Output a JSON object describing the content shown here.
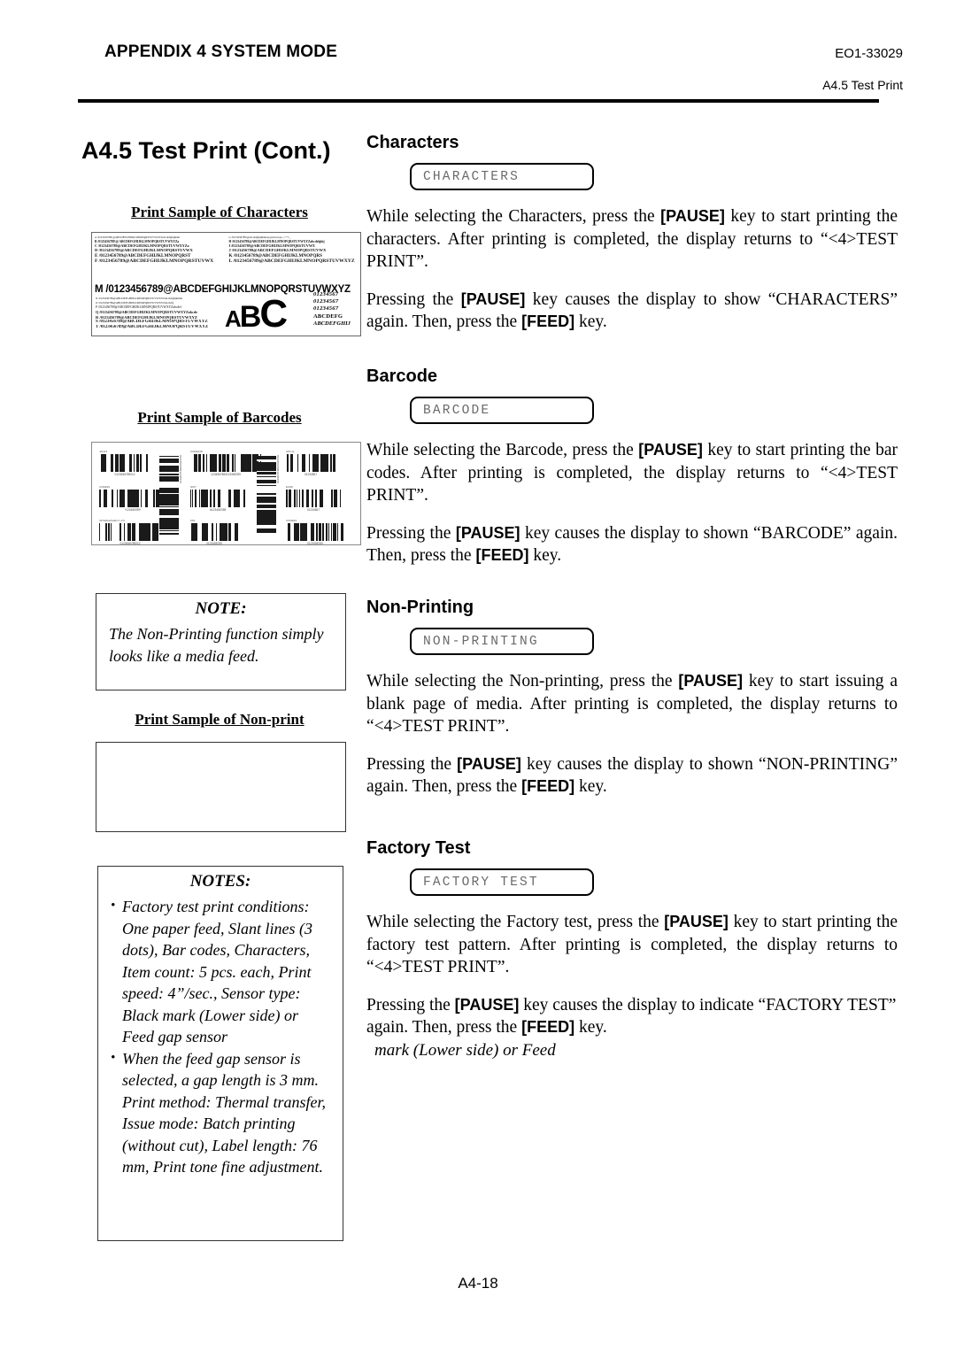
{
  "header": {
    "appendix_title": "APPENDIX 4 SYSTEM MODE",
    "doc_code": "EO1-33029",
    "section_ref": "A4.5 Test Print"
  },
  "page_title": "A4.5  Test Print (Cont.)",
  "footer": {
    "page_number": "A4-18"
  },
  "left_column": {
    "characters_sample_heading": "Print Sample of Characters",
    "barcodes_sample_heading": "Print Sample of Barcodes",
    "nonprint_sample_heading": "Print Sample of Non-print",
    "character_sample": {
      "rows_left": [
        "A /0123456789!@ABCDEFGHIJKLMNOPQRSTUVWXYZabcdefghijklmn",
        "B /0123456789!@ ABCDEFGHIJKLMNOPQRSTUVWXYZa",
        "C /0123456789@ABCDEFGHIJKLMNOPQRSTUVWXYZa",
        "D /0123456789@ABCDEFGHIJKLMNOPQRSTUVWX",
        "E /0123456789@ABCDEFGHIJKLMNOPQRST",
        "F /0123456789@ABCDEFGHIJKLMNOPQRSTUVWX"
      ],
      "rows_right": [
        "G /0123456789!@abcdefghijklmnopqrstuvwxyz,.;:'\"/?-_",
        "H /0123456789@ABCDEFGHIJKLMNOPQRSTUVWXYZabcdefghij",
        "I /0123456789@ABCDEFGHIJKLMNOPQRSTUVWX",
        "J /0123456789@ABCDEFGHIJKLMNOPQRSTUVWX",
        "K /0123456789@ABCDEFGHIJKLMNOPQRS",
        "L /0123456789@ABCDEFGHIJKLMNOPQRSTUVWXYZ"
      ],
      "big_row": "M /0123456789@ABCDEFGHIJKLMNOPQRSTUVWXYZ",
      "rows_lower": [
        "N /0123456789@ABCDEFGHIJKLMNOPQRSTUVWXYZabcdefghijklmn",
        "O /0123456789@ABCDEFGHIJKLMNOPQRSTUVWXYZabcdefg",
        "P /0123456789@ABCDEFGHIJKLMNOPQRSTUVWXYZabcdef",
        "Q /0123456789@ABCDEFGHIJKLMNOPQRSTUVWXYZabcde",
        "R /0123456789@ABCDEFGHIJKLMNOPQRSTUVWXYZ",
        "S /0123456789@ABCDEFGHIJKLMNOPQRSTUVWXYZ",
        "T /0123456789@ABCDEFGHIJKLMNOPQRSTUVWXYZ"
      ],
      "logo_letters": {
        "a": "A",
        "b": "B",
        "c": "C"
      },
      "numeral_samples": [
        "01234567",
        "01234567",
        "01234567",
        "ABCDEFG",
        "ABCDEFGHIJ"
      ]
    },
    "barcode_sample": {
      "items": [
        {
          "caption": "JAN13",
          "number": "0123456789012"
        },
        {
          "caption": "CODE39",
          "number": "*123456789*"
        },
        {
          "caption": "INTERLEAVED 2 of 5",
          "number": "0123456789012"
        },
        {
          "caption": "CODE128",
          "number": "1234567890123456789"
        },
        {
          "caption": "NW7",
          "number": "A12345678B"
        },
        {
          "caption": "MSI",
          "number": "0123456789"
        },
        {
          "caption": "UPC-E",
          "number": "01234567"
        },
        {
          "caption": "EAN8",
          "number": "01234567"
        },
        {
          "caption": "CODE93",
          "number": "0123456789"
        }
      ],
      "vertical_items": [
        {
          "number": "0123456789012345678"
        },
        {
          "number": "0123456789012345678"
        }
      ]
    },
    "note_1": {
      "title": "NOTE:",
      "body": "The Non-Printing function simply looks like a media feed."
    },
    "note_2": {
      "title": "NOTES:",
      "bullets": [
        "Factory test print conditions: One paper feed,  Slant lines (3 dots), Bar codes, Characters, Item count: 5 pcs. each, Print speed: 4”/sec., Sensor type: Black mark (Lower side) or Feed gap sensor",
        "When the feed gap sensor is selected, a gap length is 3 mm."
      ],
      "trailing": "Print method: Thermal transfer, Issue mode: Batch printing (without cut), Label length: 76 mm, Print tone fine adjustment."
    }
  },
  "right_column": {
    "sections": [
      {
        "heading": "Characters",
        "lcd": "CHARACTERS",
        "para1_a": "While selecting the Characters, press the ",
        "para1_key": "[PAUSE]",
        "para1_b": " key to start printing the characters.   After printing is completed, the display returns to “<4>TEST PRINT”.",
        "para2_a": "Pressing the ",
        "para2_key1": "[PAUSE]",
        "para2_b": " key causes the display to show “CHARACTERS” again.  Then, press the ",
        "para2_key2": "[FEED]",
        "para2_c": " key."
      },
      {
        "heading": "Barcode",
        "lcd": "BARCODE",
        "para1_a": "While selecting the Barcode, press the ",
        "para1_key": "[PAUSE]",
        "para1_b": " key to start printing the bar codes.   After printing is completed, the display returns to “<4>TEST PRINT”.",
        "para2_a": "Pressing the ",
        "para2_key1": "[PAUSE]",
        "para2_b": " key causes the display to shown “BARCODE” again.  Then, press the ",
        "para2_key2": "[FEED]",
        "para2_c": " key."
      },
      {
        "heading": "Non-Printing",
        "lcd": "NON-PRINTING",
        "para1_a": "While selecting the Non-printing, press the ",
        "para1_key": "[PAUSE]",
        "para1_b": " key to start issuing a blank page of media. After printing is completed, the display returns to “<4>TEST PRINT”.",
        "para2_a": "Pressing the ",
        "para2_key1": "[PAUSE]",
        "para2_b": " key causes the display to shown “NON-PRINTING” again.  Then, press the ",
        "para2_key2": "[FEED]",
        "para2_c": " key."
      },
      {
        "heading": "Factory Test",
        "lcd": "FACTORY TEST",
        "para1_a": "While selecting the Factory test, press the ",
        "para1_key": "[PAUSE]",
        "para1_b": " key to start printing the factory test pattern.  After printing is completed, the display returns to “<4>TEST PRINT”.",
        "para2_a": "Pressing the ",
        "para2_key1": "[PAUSE]",
        "para2_b": " key causes the display to indicate “FACTORY TEST” again. Then, press the ",
        "para2_key2": "[FEED]",
        "para2_c": " key.",
        "stray_line": "mark (Lower side) or Feed"
      }
    ]
  }
}
